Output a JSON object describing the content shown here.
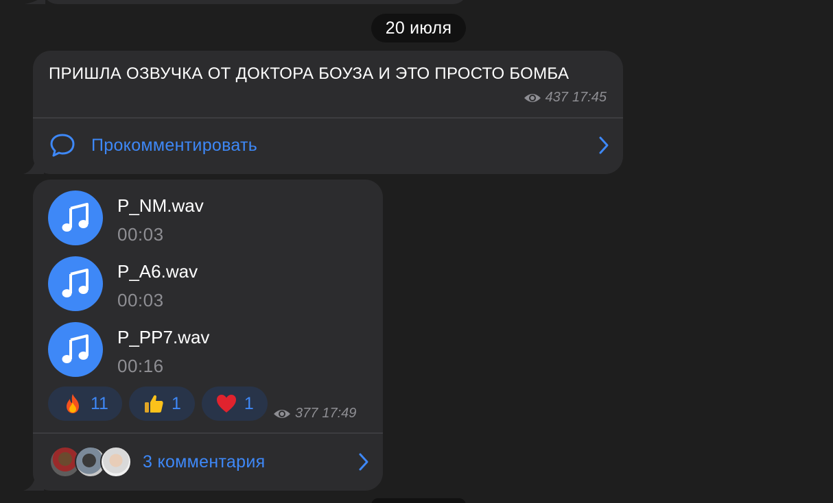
{
  "date_pill": "20 июля",
  "post1": {
    "text": "ПРИШЛА ОЗВУЧКА ОТ ДОКТОРА БОУЗА И ЭТО ПРОСТО БОМБА",
    "views": "437",
    "time": "17:45",
    "comment_action": "Прокомментировать"
  },
  "post2": {
    "tracks": [
      {
        "title": "P_NM.wav",
        "duration": "00:03"
      },
      {
        "title": "P_A6.wav",
        "duration": "00:03"
      },
      {
        "title": "P_PP7.wav",
        "duration": "00:16"
      }
    ],
    "reactions": [
      {
        "emoji": "fire",
        "count": "11"
      },
      {
        "emoji": "thumbs-up",
        "count": "1"
      },
      {
        "emoji": "heart",
        "count": "1"
      }
    ],
    "views": "377",
    "time": "17:49",
    "comments_label": "3 комментария"
  },
  "colors": {
    "background": "#1e1e1e",
    "bubble": "#2c2c2e",
    "accent": "#3e88f7",
    "meta": "#8e8e93",
    "reaction_bg": "#283449"
  }
}
